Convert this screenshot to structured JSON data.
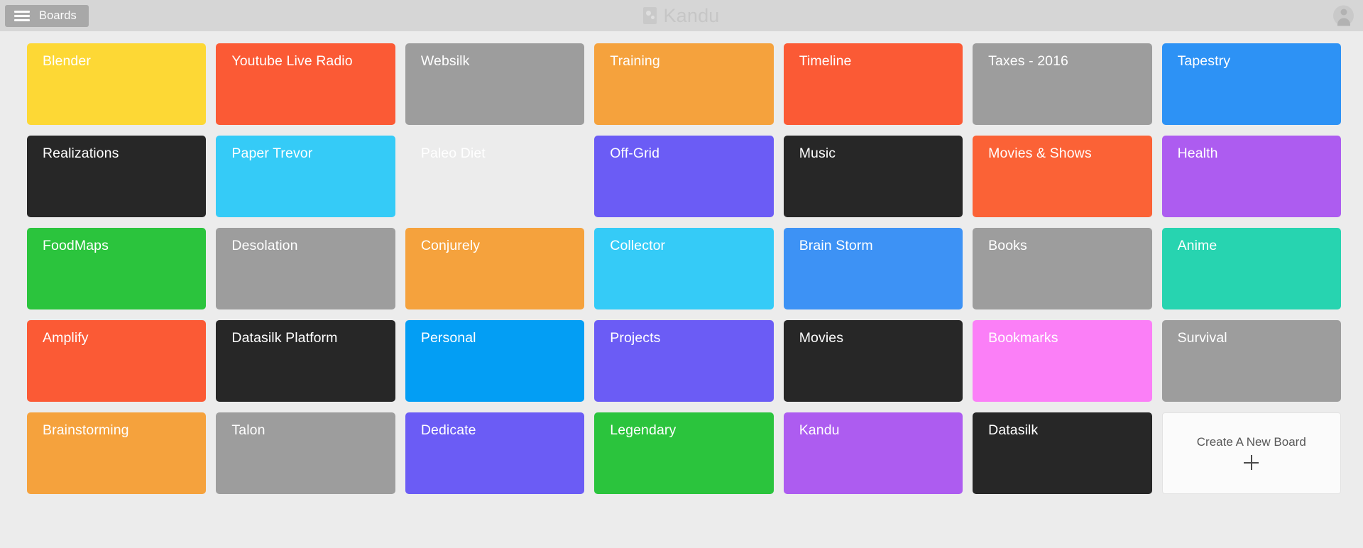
{
  "topbar": {
    "boards_button_label": "Boards",
    "menu_icon": "hamburger-icon",
    "brand_title": "Kandu",
    "brand_logo_icon": "kandu-logo-icon",
    "avatar_icon": "user-avatar-icon"
  },
  "create_board": {
    "label": "Create A New Board",
    "icon": "plus-icon"
  },
  "boards": [
    {
      "label": "Blender",
      "color": "#fdd835"
    },
    {
      "label": "Youtube Live Radio",
      "color": "#fb5a35"
    },
    {
      "label": "Websilk",
      "color": "#9d9d9d"
    },
    {
      "label": "Training",
      "color": "#f5a23d"
    },
    {
      "label": "Timeline",
      "color": "#fb5a35"
    },
    {
      "label": "Taxes - 2016",
      "color": "#9d9d9d"
    },
    {
      "label": "Tapestry",
      "color": "#2d92f5"
    },
    {
      "label": "Realizations",
      "color": "#272727"
    },
    {
      "label": "Paper Trevor",
      "color": "#35cbf7"
    },
    {
      "label": "Paleo Diet",
      "color": "#2bc githubc"
    },
    {
      "label": "Off-Grid",
      "color": "#6b5cf5"
    },
    {
      "label": "Music",
      "color": "#272727"
    },
    {
      "label": "Movies & Shows",
      "color": "#fb6236"
    },
    {
      "label": "Health",
      "color": "#ad5cf0"
    },
    {
      "label": "FoodMaps",
      "color": "#2bc43d"
    },
    {
      "label": "Desolation",
      "color": "#9d9d9d"
    },
    {
      "label": "Conjurely",
      "color": "#f5a23d"
    },
    {
      "label": "Collector",
      "color": "#35cbf7"
    },
    {
      "label": "Brain Storm",
      "color": "#3d92f5"
    },
    {
      "label": "Books",
      "color": "#9d9d9d"
    },
    {
      "label": "Anime",
      "color": "#27d4b0"
    },
    {
      "label": "Amplify",
      "color": "#fb5a35"
    },
    {
      "label": "Datasilk Platform",
      "color": "#272727"
    },
    {
      "label": "Personal",
      "color": "#039ef4"
    },
    {
      "label": "Projects",
      "color": "#6b5cf5"
    },
    {
      "label": "Movies",
      "color": "#272727"
    },
    {
      "label": "Bookmarks",
      "color": "#fb7ff7"
    },
    {
      "label": "Survival",
      "color": "#9d9d9d"
    },
    {
      "label": "Brainstorming",
      "color": "#f5a23d"
    },
    {
      "label": "Talon",
      "color": "#9d9d9d"
    },
    {
      "label": "Dedicate",
      "color": "#6b5cf5"
    },
    {
      "label": "Legendary",
      "color": "#2bc43d"
    },
    {
      "label": "Kandu",
      "color": "#ad5cf0"
    },
    {
      "label": "Datasilk",
      "color": "#272727"
    }
  ]
}
